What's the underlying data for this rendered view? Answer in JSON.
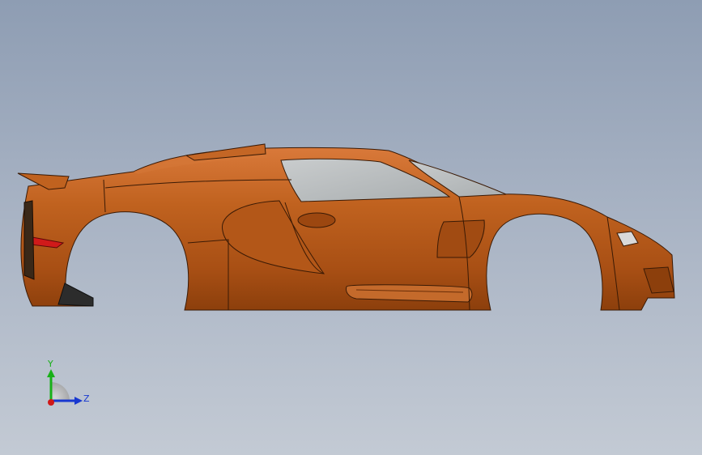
{
  "model": {
    "name": "car-body-side-view"
  },
  "colors": {
    "background_top": "#8e9db3",
    "background_bottom": "#c3cad4",
    "body": "#b85a1c",
    "body_dark": "#7e3a0c",
    "glass": "#b7bcbf",
    "x_axis": "#d01818",
    "y_axis": "#18b018",
    "z_axis": "#1838d0"
  },
  "triad": {
    "y_label": "Y",
    "z_label": "Z",
    "y_color": "#18b018",
    "z_color": "#1838d0"
  }
}
